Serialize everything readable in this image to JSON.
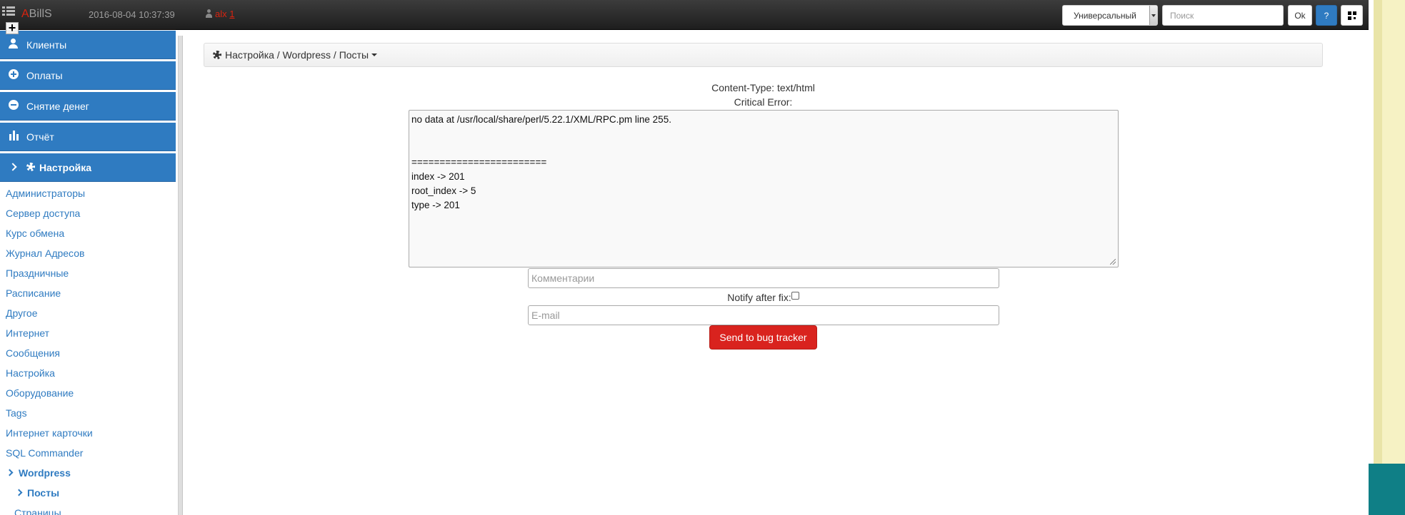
{
  "header": {
    "brand_first": "A",
    "brand_rest": "BillS",
    "datetime": "2016-08-04 10:37:39",
    "user_name": "alx",
    "user_num": "1",
    "select_value": "Универсальный",
    "search_placeholder": "Поиск",
    "ok_label": "Ok",
    "help_label": "?",
    "plus_label": "+"
  },
  "sidebar": {
    "main_items": [
      {
        "label": "Клиенты",
        "icon": "user-icon"
      },
      {
        "label": "Оплаты",
        "icon": "plus-circle-icon"
      },
      {
        "label": "Снятие денег",
        "icon": "minus-circle-icon"
      },
      {
        "label": "Отчёт",
        "icon": "bar-chart-icon"
      },
      {
        "label": "Настройка",
        "icon": "gear-icon"
      }
    ],
    "sub_items": [
      "Администраторы",
      "Сервер доступа",
      "Курс обмена",
      "Журнал Адресов",
      "Праздничные",
      "Расписание",
      "Другое",
      "Интернет",
      "Сообщения",
      "Настройка",
      "Оборудование",
      "Tags",
      "Интернет карточки",
      "SQL Commander"
    ],
    "wordpress": "Wordpress",
    "posts": "Посты",
    "pages": "Страницы"
  },
  "breadcrumb": {
    "text": "Настройка / Wordpress / Посты"
  },
  "error": {
    "content_type": "Content-Type: text/html",
    "critical": "Critical Error:",
    "lines": [
      "no data at /usr/local/share/perl/5.22.1/XML/RPC.pm line 255.",
      "",
      "",
      "========================",
      "index -> 201",
      "root_index -> 5",
      "type -> 201"
    ]
  },
  "form": {
    "comments_placeholder": "Комментарии",
    "notify_label": "Notify after fix:",
    "email_placeholder": "E-mail",
    "send_label": "Send to bug tracker"
  },
  "colors": {
    "accent": "#2f7bc1",
    "danger": "#d9231e"
  }
}
